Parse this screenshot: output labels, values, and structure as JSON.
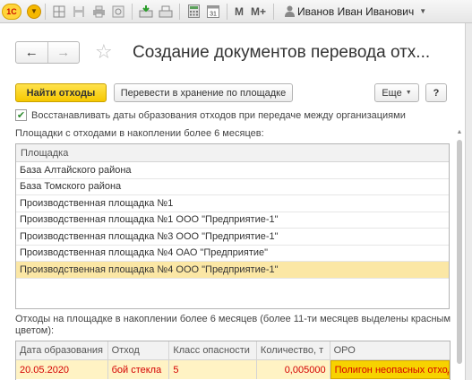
{
  "topbar": {
    "logo_text": "1С",
    "m_label": "M",
    "mplus_label": "M+",
    "user_name": "Иванов Иван Иванович"
  },
  "form": {
    "title": "Создание документов перевода отх...",
    "back_glyph": "←",
    "forward_glyph": "→",
    "favorite_glyph": "☆"
  },
  "commands": {
    "find_label": "Найти отходы",
    "move_label": "Перевести в хранение по площадке",
    "more_label": "Еще",
    "help_label": "?"
  },
  "restore_dates": {
    "checked": true,
    "label": "Восстанавливать даты образования отходов при передаче между организациями"
  },
  "sites": {
    "caption": "Площадки с отходами в накоплении более 6 месяцев:",
    "header": "Площадка",
    "rows": [
      "База Алтайского района",
      "База Томского района",
      "Производственная площадка №1",
      "Производственная площадка №1 ООО \"Предприятие-1\"",
      "Производственная площадка №3 ООО \"Предприятие-1\"",
      "Производственная площадка №4 ОАО \"Предприятие\"",
      "Производственная площадка №4 ООО \"Предприятие-1\""
    ],
    "selected_index": 6
  },
  "waste": {
    "caption": "Отходы на площадке в накоплении более 6 месяцев (более 11-ти месяцев выделены красным",
    "caption_line2": "цветом):",
    "columns": [
      "Дата образования",
      "Отход",
      "Класс опасности",
      "Количество, т",
      "ОРО"
    ],
    "rows": [
      [
        "20.05.2020",
        "бой стекла",
        "5",
        "0,005000",
        "Полигон неопасных отходов"
      ]
    ]
  },
  "colors": {
    "accent_yellow": "#f6c800",
    "selected_row": "#fbe7a5",
    "overdue_text": "#d40000"
  }
}
